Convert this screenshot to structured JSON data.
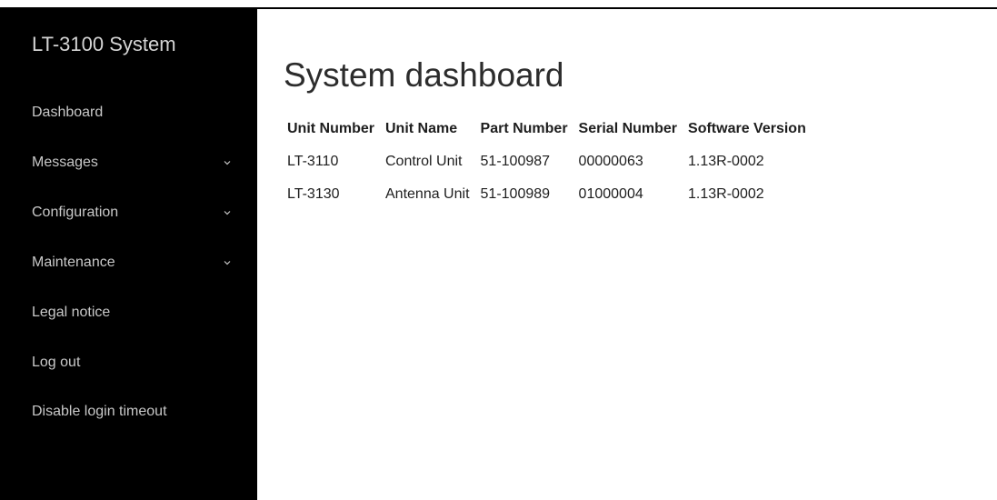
{
  "sidebar": {
    "title": "LT-3100 System",
    "items": [
      {
        "label": "Dashboard",
        "has_submenu": false
      },
      {
        "label": "Messages",
        "has_submenu": true
      },
      {
        "label": "Configuration",
        "has_submenu": true
      },
      {
        "label": "Maintenance",
        "has_submenu": true
      },
      {
        "label": "Legal notice",
        "has_submenu": false
      },
      {
        "label": "Log out",
        "has_submenu": false
      },
      {
        "label": "Disable login timeout",
        "has_submenu": false
      }
    ],
    "chevron_icon": "chevron-down-icon"
  },
  "main": {
    "title": "System dashboard",
    "table": {
      "headers": [
        "Unit Number",
        "Unit Name",
        "Part Number",
        "Serial Number",
        "Software Version"
      ],
      "rows": [
        [
          "LT-3110",
          "Control Unit",
          "51-100987",
          "00000063",
          "1.13R-0002"
        ],
        [
          "LT-3130",
          "Antenna Unit",
          "51-100989",
          "01000004",
          "1.13R-0002"
        ]
      ]
    }
  },
  "colors": {
    "sidebar_bg": "#000000",
    "sidebar_text": "#c8c8c8",
    "page_bg": "#ffffff",
    "title_text": "#2c2c2c"
  }
}
